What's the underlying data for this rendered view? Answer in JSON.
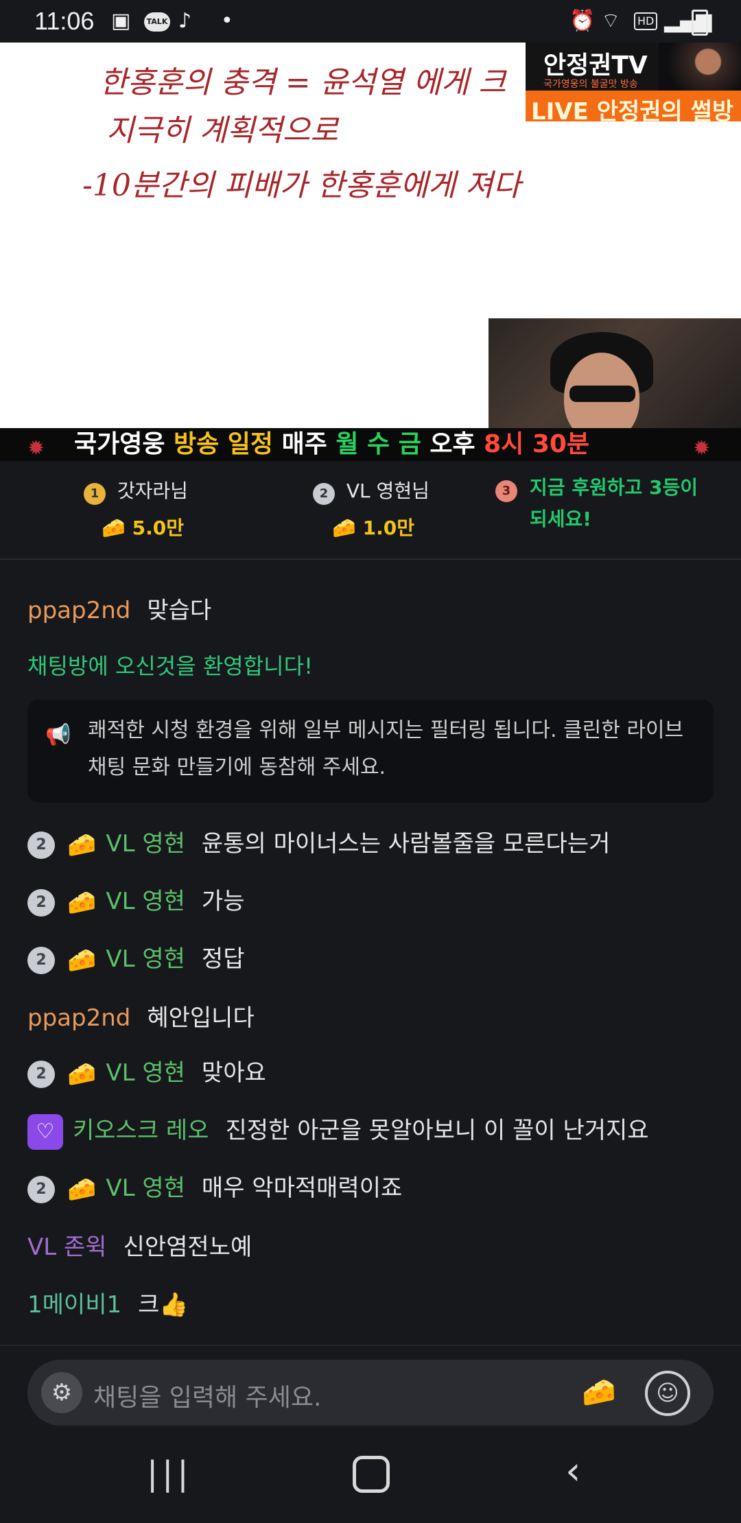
{
  "status_bar": {
    "time": "11:06",
    "icons": [
      "image-icon",
      "talk-icon",
      "tiktok-icon",
      "dot-icon",
      "alarm-icon",
      "wifi-icon",
      "hd-icon",
      "signal-icon",
      "battery-icon"
    ],
    "talk_label": "TALK",
    "hd_label": "HD"
  },
  "video": {
    "handwriting_line1": "한홍훈의 충격 = 윤석열 에게 크",
    "handwriting_line2": "지극히 계획적으로",
    "handwriting_line3": "-10분간의 피배가 한홍훈에게 져다",
    "channel_title": "안정권TV",
    "channel_sub": "국가영웅의 불굴맛 방송",
    "live_label": "LIVE 안정권의 썰방",
    "banner_part1": "국가영웅",
    "banner_part2": "방송 일정",
    "banner_part3": "매주",
    "banner_part4": "월 수 금",
    "banner_part5": "오후",
    "banner_part6": "8시 30분"
  },
  "donors": {
    "first": {
      "rank": "1",
      "name": "갓자라님",
      "amount": "5.0만"
    },
    "second": {
      "rank": "2",
      "name": "VL 영현님",
      "amount": "1.0만"
    },
    "third": {
      "rank": "3",
      "cta_line1": "지금 후원하고 3등이",
      "cta_line2": "되세요!"
    }
  },
  "chat": {
    "messages": [
      {
        "nick": "ppap2nd",
        "text": "맞습다"
      },
      {
        "system": "채팅방에 오신것을 환영합니다!"
      },
      {
        "notice": "쾌적한 시청 환경을 위해 일부 메시지는 필터링 됩니다. 클린한 라이브 채팅 문화 만들기에 동참해 주세요."
      },
      {
        "badge": "2",
        "nick": "VL 영현",
        "text": "윤통의 마이너스는 사람볼줄을 모른다는거"
      },
      {
        "badge": "2",
        "nick": "VL 영현",
        "text": "가능"
      },
      {
        "badge": "2",
        "nick": "VL 영현",
        "text": "정답"
      },
      {
        "nick": "ppap2nd",
        "text": "혜안입니다"
      },
      {
        "badge": "2",
        "nick": "VL 영현",
        "text": "맞아요"
      },
      {
        "nick": "키오스크 레오",
        "text": "진정한 아군을 못알아보니 이 꼴이 난거지요"
      },
      {
        "badge": "2",
        "nick": "VL 영현",
        "text": "매우 악마적매력이죠"
      },
      {
        "nick": "VL 존윅",
        "text": "신안염전노예"
      },
      {
        "nick": "1메이비1",
        "text": "크👍"
      }
    ]
  },
  "input": {
    "placeholder": "채팅을 입력해 주세요."
  },
  "colors": {
    "background": "#17181c",
    "accent_green": "#2fc97b",
    "nick_orange": "#e89a5b",
    "nick_green": "#5cc06a",
    "nick_purple": "#9f6fd1",
    "cheese_yellow": "#f6c419"
  }
}
